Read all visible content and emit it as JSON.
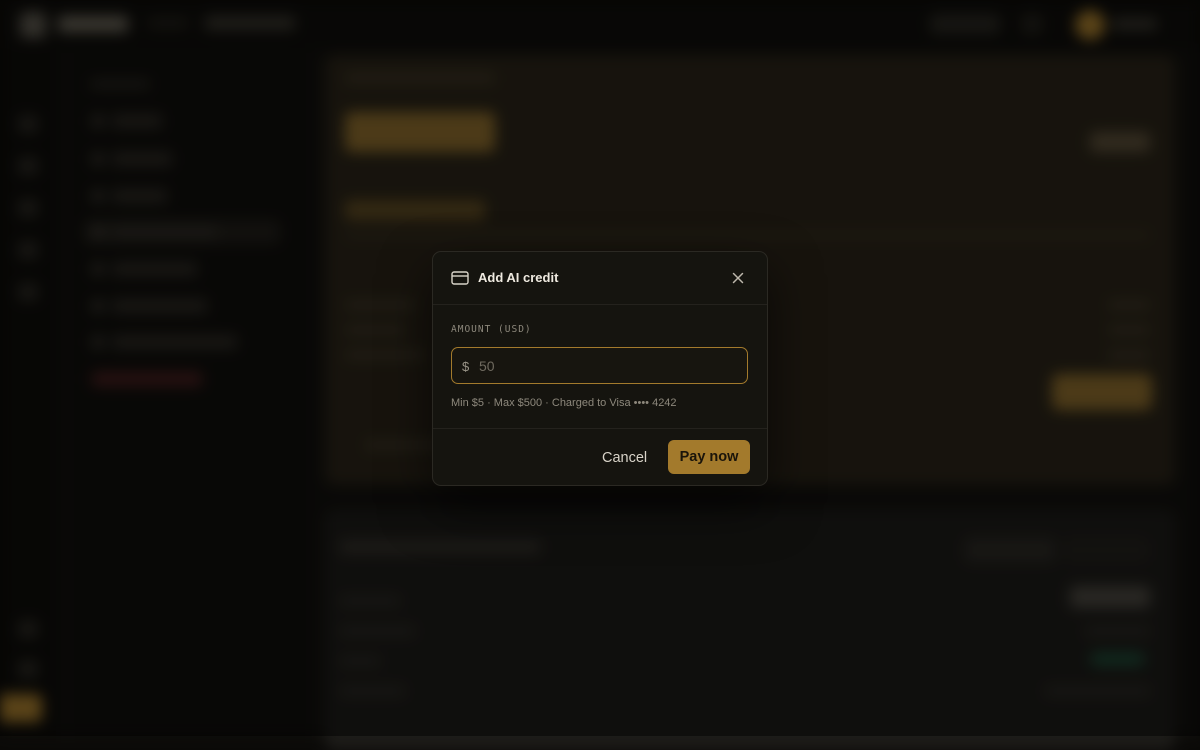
{
  "modal": {
    "title": "Add AI credit",
    "title_icon": "credit-card-icon",
    "close_icon": "close-icon",
    "amount_label": "AMOUNT (USD)",
    "currency_symbol": "$",
    "amount_placeholder": "50",
    "hint": "Min $5 · Max $500 · Charged to Visa •••• 4242",
    "cancel_label": "Cancel",
    "pay_label": "Pay now"
  },
  "colors": {
    "accent": "#a37a2c",
    "modal_bg": "#15140f",
    "overlay": "rgba(0,0,0,0.45)"
  }
}
